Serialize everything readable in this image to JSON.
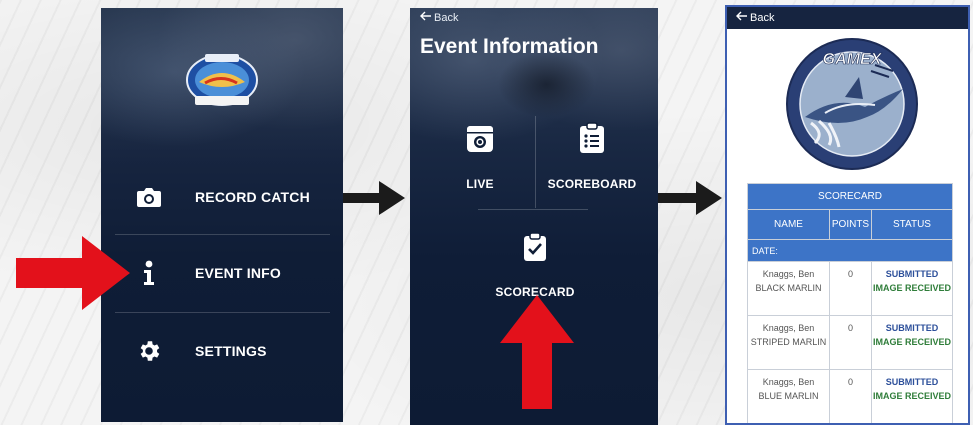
{
  "screen1": {
    "menu": [
      {
        "label": "RECORD CATCH",
        "icon": "camera-icon"
      },
      {
        "label": "EVENT INFO",
        "icon": "info-icon"
      },
      {
        "label": "SETTINGS",
        "icon": "gear-icon"
      }
    ]
  },
  "screen2": {
    "back_label": "Back",
    "title": "Event Information",
    "tiles": [
      {
        "label": "LIVE",
        "icon": "live-camera-icon"
      },
      {
        "label": "SCOREBOARD",
        "icon": "clipboard-list-icon"
      },
      {
        "label": "SCORECARD",
        "icon": "clipboard-check-icon"
      }
    ]
  },
  "screen3": {
    "back_label": "Back",
    "logo_text": "GAMEX",
    "scorecard": {
      "title": "SCORECARD",
      "columns": [
        "NAME",
        "POINTS",
        "STATUS"
      ],
      "date_label": "DATE:",
      "rows": [
        {
          "name": "Knaggs, Ben",
          "species": "BLACK MARLIN",
          "points": "0",
          "status": "SUBMITTED",
          "image_status": "IMAGE RECEIVED"
        },
        {
          "name": "Knaggs, Ben",
          "species": "STRIPED MARLIN",
          "points": "0",
          "status": "SUBMITTED",
          "image_status": "IMAGE RECEIVED"
        },
        {
          "name": "Knaggs, Ben",
          "species": "BLUE MARLIN",
          "points": "0",
          "status": "SUBMITTED",
          "image_status": "IMAGE RECEIVED"
        }
      ]
    }
  },
  "colors": {
    "app_navy": "#0d1b34",
    "table_blue": "#3d74c7",
    "arrow_red": "#e3111b",
    "submitted_blue": "#2c4f9a",
    "received_green": "#2f7d3a"
  }
}
